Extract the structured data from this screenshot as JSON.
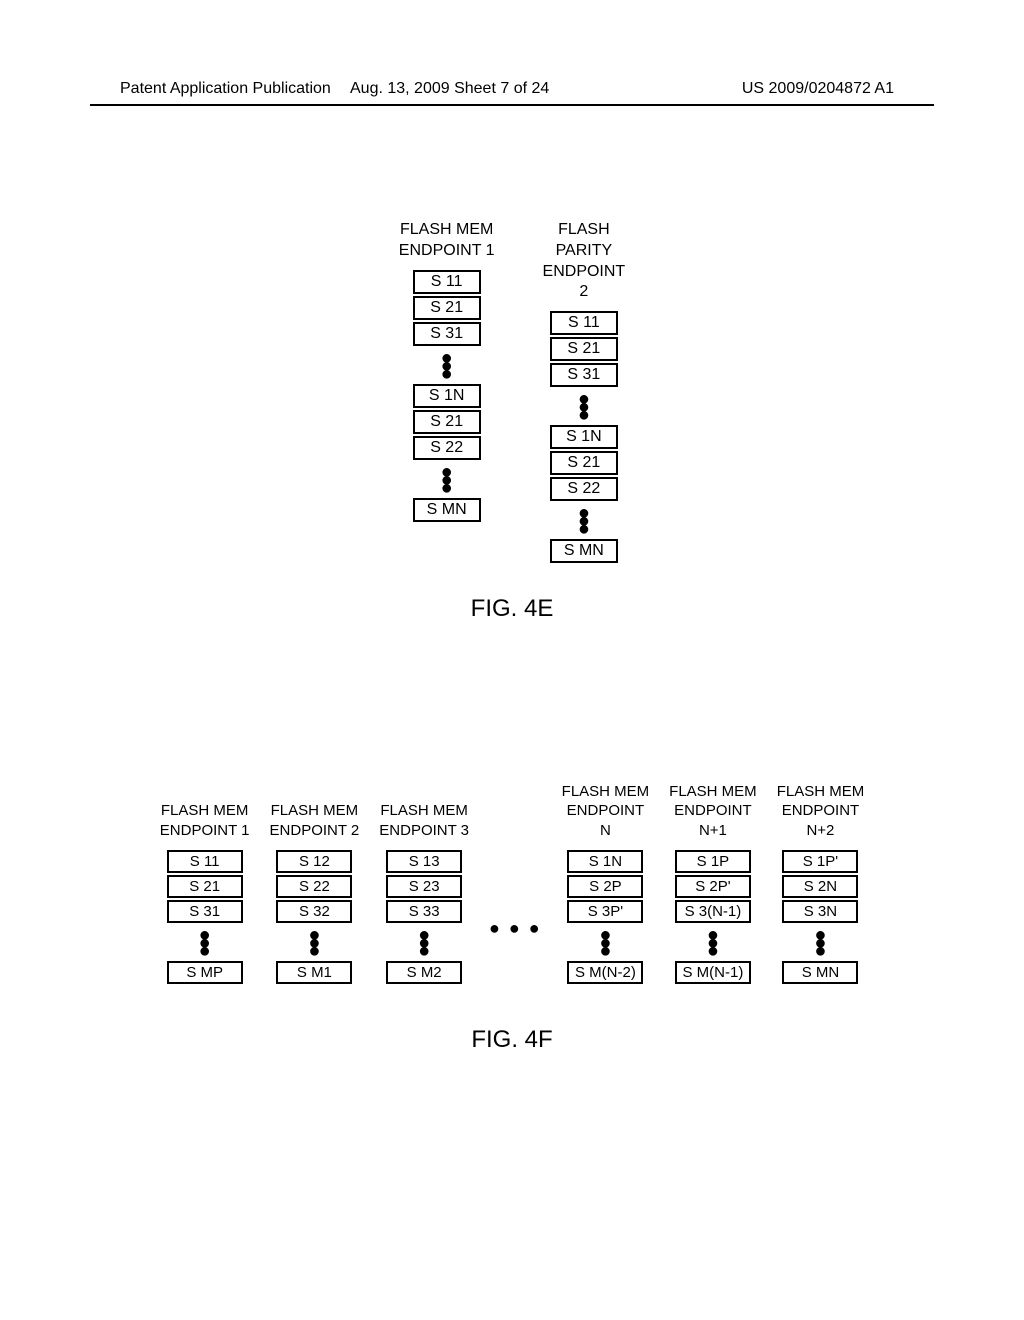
{
  "header": {
    "left": "Patent Application Publication",
    "center": "Aug. 13, 2009  Sheet 7 of 24",
    "right": "US 2009/0204872 A1"
  },
  "fig4e": {
    "caption": "FIG. 4E",
    "columns": [
      {
        "title": "FLASH MEM\nENDPOINT 1",
        "groups": [
          [
            "S  11",
            "S  21",
            "S  31"
          ],
          [
            "S  1N",
            "S  21",
            "S  22"
          ],
          [
            "S  MN"
          ]
        ]
      },
      {
        "title": "FLASH\nPARITY\nENDPOINT\n2",
        "groups": [
          [
            "S  11",
            "S  21",
            "S  31"
          ],
          [
            "S  1N",
            "S  21",
            "S  22"
          ],
          [
            "S  MN"
          ]
        ]
      }
    ]
  },
  "fig4f": {
    "caption": "FIG. 4F",
    "hdots": "● ● ●",
    "columns": [
      {
        "title": "FLASH MEM\nENDPOINT 1",
        "cells_top": [
          "S  11",
          "S  21",
          "S  31"
        ],
        "cell_bottom": "S  MP"
      },
      {
        "title": "FLASH MEM\nENDPOINT 2",
        "cells_top": [
          "S  12",
          "S  22",
          "S  32"
        ],
        "cell_bottom": "S  M1"
      },
      {
        "title": "FLASH MEM\nENDPOINT 3",
        "cells_top": [
          "S  13",
          "S  23",
          "S  33"
        ],
        "cell_bottom": "S  M2"
      },
      {
        "title": "FLASH MEM\nENDPOINT\nN",
        "cells_top": [
          "S  1N",
          "S  2P",
          "S  3P'"
        ],
        "cell_bottom": "S  M(N-2)"
      },
      {
        "title": "FLASH MEM\nENDPOINT\nN+1",
        "cells_top": [
          "S  1P",
          "S  2P'",
          "S 3(N-1)"
        ],
        "cell_bottom": "S  M(N-1)"
      },
      {
        "title": "FLASH MEM\nENDPOINT\nN+2",
        "cells_top": [
          "S  1P'",
          "S  2N",
          "S  3N"
        ],
        "cell_bottom": "S  MN"
      }
    ]
  }
}
